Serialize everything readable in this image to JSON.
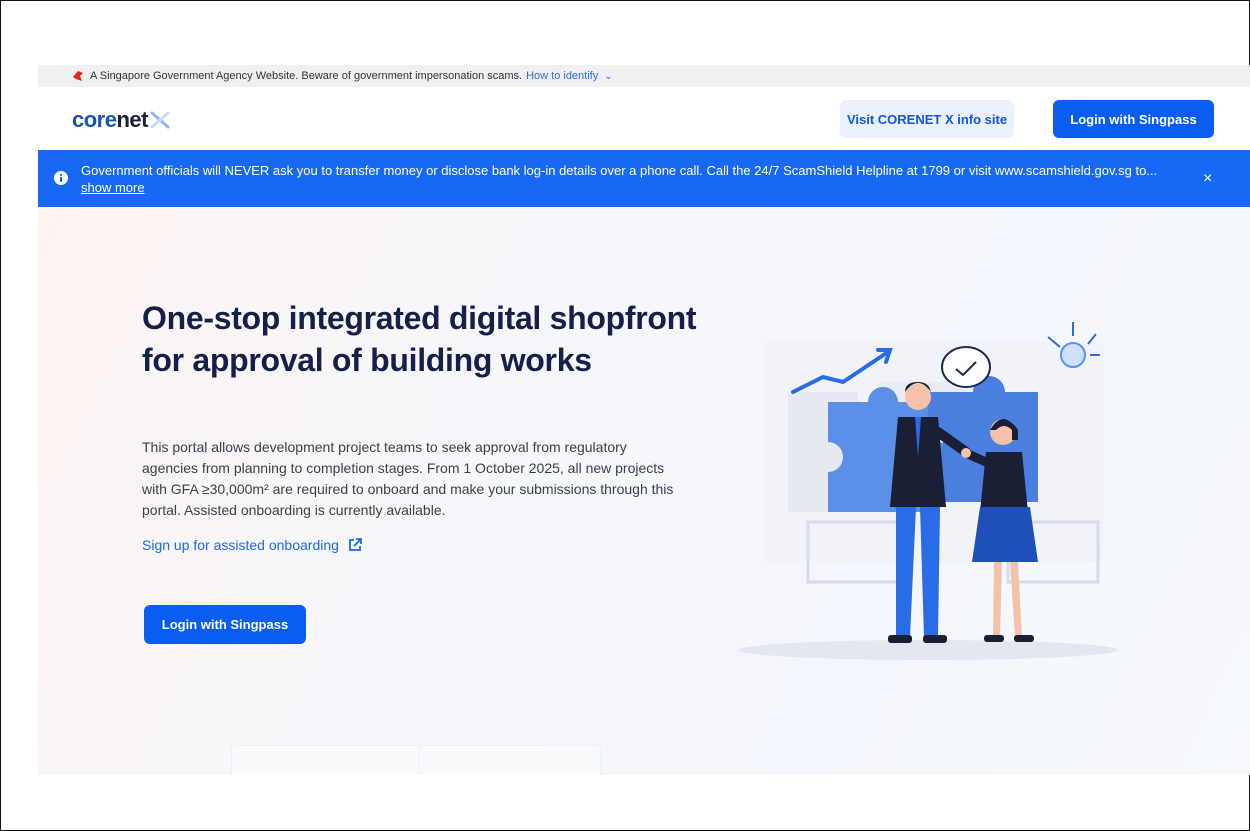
{
  "masthead": {
    "text": "A Singapore Government Agency Website. Beware of government impersonation scams.",
    "identify_link": "How to identify"
  },
  "header": {
    "logo_core": "core",
    "logo_net": "net",
    "info_button": "Visit CORENET X info site",
    "login_button": "Login with Singpass"
  },
  "alert": {
    "message": "Government officials will NEVER ask you to transfer money or disclose bank log-in details over a phone call. Call the 24/7 ScamShield Helpline at 1799 or visit www.scamshield.gov.sg to...",
    "show_more": "show more",
    "close": "×"
  },
  "hero": {
    "title": "One-stop integrated digital shopfront for approval of building works",
    "description": "This portal allows development project teams to seek approval from regulatory agencies from planning to completion stages. From 1 October 2025, all new projects with GFA ≥30,000m² are required to onboard and make your submissions through this portal. Assisted onboarding is currently available.",
    "signup_link": "Sign up for assisted onboarding",
    "login_button": "Login with Singpass"
  },
  "colors": {
    "primary": "#0b5cf0",
    "alert_bg": "#1769f4",
    "heading": "#14204a"
  }
}
